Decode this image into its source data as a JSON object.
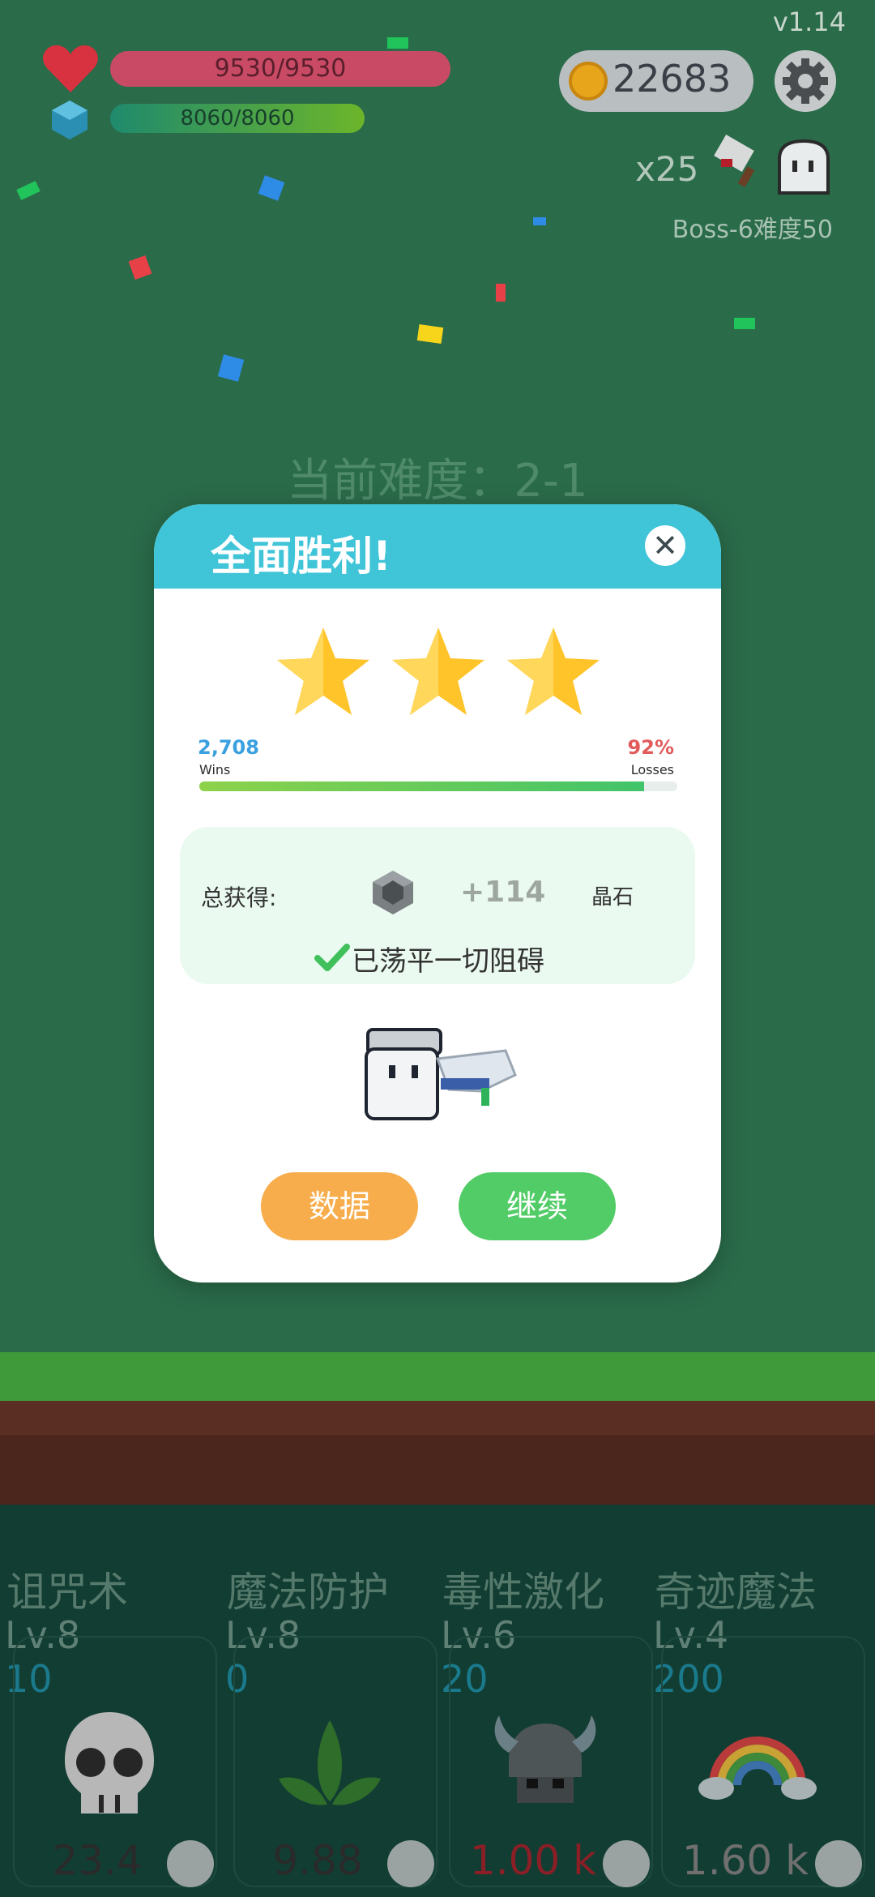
{
  "version": "v1.14",
  "player": {
    "hp": "9530/9530",
    "mp": "8060/8060"
  },
  "coins": "22683",
  "boss": {
    "multiplier": "x25",
    "label": "Boss-6难度50"
  },
  "difficulty_text": "当前难度：2-1",
  "modal": {
    "title": "全面胜利!",
    "stars": 3,
    "wins_value": "2,708",
    "wins_label": "Wins",
    "losses_value": "92%",
    "losses_label": "Losses",
    "progress": 0.93,
    "reward_label": "总获得:",
    "reward_amount": "+114",
    "reward_unit": "晶石",
    "cleared_text": "已荡平一切阻碍",
    "button_data": "数据",
    "button_continue": "继续"
  },
  "skills": [
    {
      "name": "诅咒术",
      "level": "Lv.8",
      "cost": "10",
      "value": "23.4",
      "icon": "skull-icon"
    },
    {
      "name": "魔法防护",
      "level": "Lv.8",
      "cost": "0",
      "value": "9.88",
      "icon": "leaf-icon"
    },
    {
      "name": "毒性激化",
      "level": "Lv.6",
      "cost": "20",
      "value": "1.00 k",
      "icon": "viking-helmet-icon"
    },
    {
      "name": "奇迹魔法",
      "level": "Lv.4",
      "cost": "200",
      "value": "1.60 k",
      "icon": "rainbow-icon"
    }
  ],
  "colors": {
    "background": "#2a6b4a",
    "modal_header": "#3fc4d8",
    "button_data": "#f7ad4c",
    "button_continue": "#52cc66",
    "star": "#ffc42a"
  }
}
